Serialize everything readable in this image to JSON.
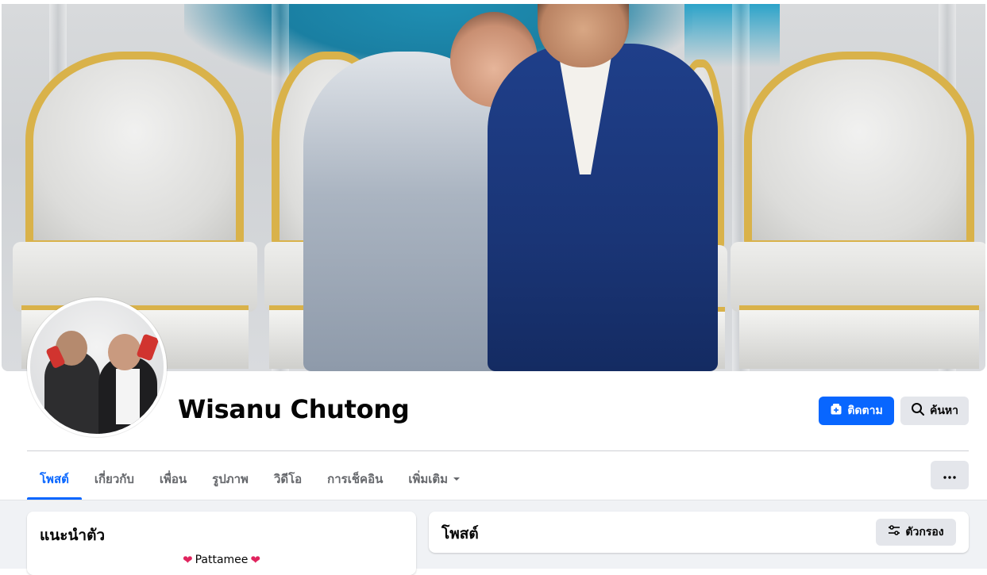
{
  "profile": {
    "name": "Wisanu Chutong"
  },
  "actions": {
    "follow_label": "ติดตาม",
    "search_label": "ค้นหา",
    "more_icon": "ellipsis-icon"
  },
  "tabs": [
    {
      "label": "โพสต์",
      "active": true
    },
    {
      "label": "เกี่ยวกับ",
      "active": false
    },
    {
      "label": "เพื่อน",
      "active": false
    },
    {
      "label": "รูปภาพ",
      "active": false
    },
    {
      "label": "วิดีโอ",
      "active": false
    },
    {
      "label": "การเช็คอิน",
      "active": false
    },
    {
      "label": "เพิ่มเติม",
      "active": false
    }
  ],
  "intro": {
    "title": "แนะนำตัว",
    "bio_text": "Pattamee"
  },
  "posts": {
    "title": "โพสต์",
    "filter_label": "ตัวกรอง"
  },
  "colors": {
    "accent": "#0866ff",
    "secondary_button": "#e4e6eb",
    "heart": "#e0245e"
  }
}
